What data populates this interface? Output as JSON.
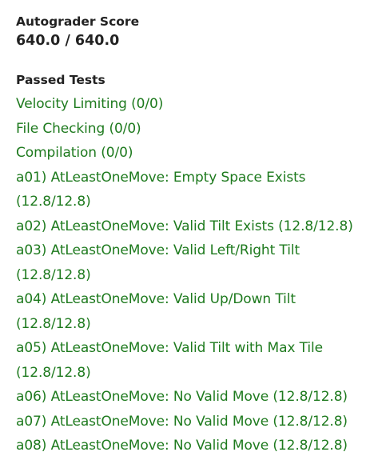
{
  "score": {
    "label": "Autograder Score",
    "value": "640.0 / 640.0"
  },
  "passed": {
    "heading": "Passed Tests",
    "color": "#1e7a1e",
    "tests": [
      "Velocity Limiting (0/0)",
      "File Checking (0/0)",
      "Compilation (0/0)",
      "a01) AtLeastOneMove: Empty Space Exists (12.8/12.8)",
      "a02) AtLeastOneMove: Valid Tilt Exists (12.8/12.8)",
      "a03) AtLeastOneMove: Valid Left/Right Tilt (12.8/12.8)",
      "a04) AtLeastOneMove: Valid Up/Down Tilt (12.8/12.8)",
      "a05) AtLeastOneMove: Valid Tilt with Max Tile (12.8/12.8)",
      "a06) AtLeastOneMove: No Valid Move (12.8/12.8)",
      "a07) AtLeastOneMove: No Valid Move (12.8/12.8)",
      "a08) AtLeastOneMove: No Valid Move (12.8/12.8)"
    ]
  }
}
